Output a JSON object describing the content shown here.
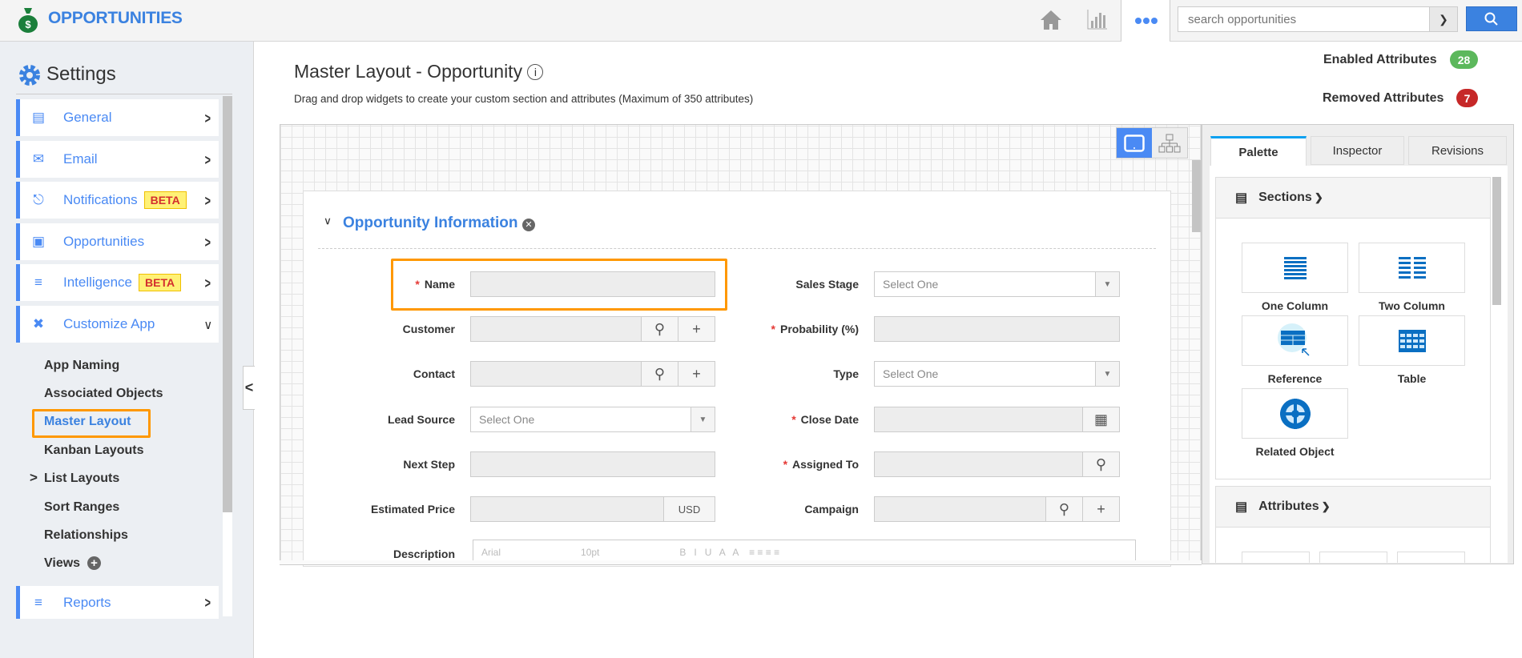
{
  "app": {
    "title": "OPPORTUNITIES",
    "search_placeholder": "search opportunities"
  },
  "sidebar": {
    "title": "Settings",
    "items": [
      {
        "label": "General",
        "icon": "monitor-icon"
      },
      {
        "label": "Email",
        "icon": "envelope-icon"
      },
      {
        "label": "Notifications",
        "icon": "bell-icon",
        "badge": "BETA"
      },
      {
        "label": "Opportunities",
        "icon": "window-icon"
      },
      {
        "label": "Intelligence",
        "icon": "list-icon",
        "badge": "BETA"
      },
      {
        "label": "Customize App",
        "icon": "tools-icon"
      },
      {
        "label": "Reports",
        "icon": "report-icon"
      }
    ],
    "subitems": [
      "App Naming",
      "Associated Objects",
      "Master Layout",
      "Kanban Layouts",
      "List Layouts",
      "Sort Ranges",
      "Relationships",
      "Views"
    ]
  },
  "main": {
    "title": "Master Layout - Opportunity",
    "subtitle": "Drag and drop widgets to create your custom section and attributes (Maximum of 350 attributes)",
    "enabled_label": "Enabled Attributes",
    "enabled_count": "28",
    "removed_label": "Removed Attributes",
    "removed_count": "7",
    "section_title": "Opportunity Information",
    "fields_left": [
      {
        "label": "Name",
        "required": "*"
      },
      {
        "label": "Customer"
      },
      {
        "label": "Contact"
      },
      {
        "label": "Lead Source",
        "value": "Select One"
      },
      {
        "label": "Next Step"
      },
      {
        "label": "Estimated Price",
        "addon": "USD"
      },
      {
        "label": "Description"
      }
    ],
    "fields_right": [
      {
        "label": "Sales Stage",
        "value": "Select One"
      },
      {
        "label": "Probability (%)",
        "required": "*"
      },
      {
        "label": "Type",
        "value": "Select One"
      },
      {
        "label": "Close Date",
        "required": "*"
      },
      {
        "label": "Assigned To",
        "required": "*"
      },
      {
        "label": "Campaign"
      }
    ],
    "editor_toolbar": {
      "font": "Arial",
      "size": "10pt"
    }
  },
  "panel": {
    "tabs": [
      "Palette",
      "Inspector",
      "Revisions"
    ],
    "sections_label": "Sections",
    "attributes_label": "Attributes",
    "tiles": [
      "One Column",
      "Two Column",
      "Reference",
      "Table",
      "Related Object"
    ]
  },
  "colors": {
    "accent": "#4a8af4",
    "highlight": "#ff9800",
    "enabled": "#5cb85c",
    "removed": "#d32f2f"
  }
}
